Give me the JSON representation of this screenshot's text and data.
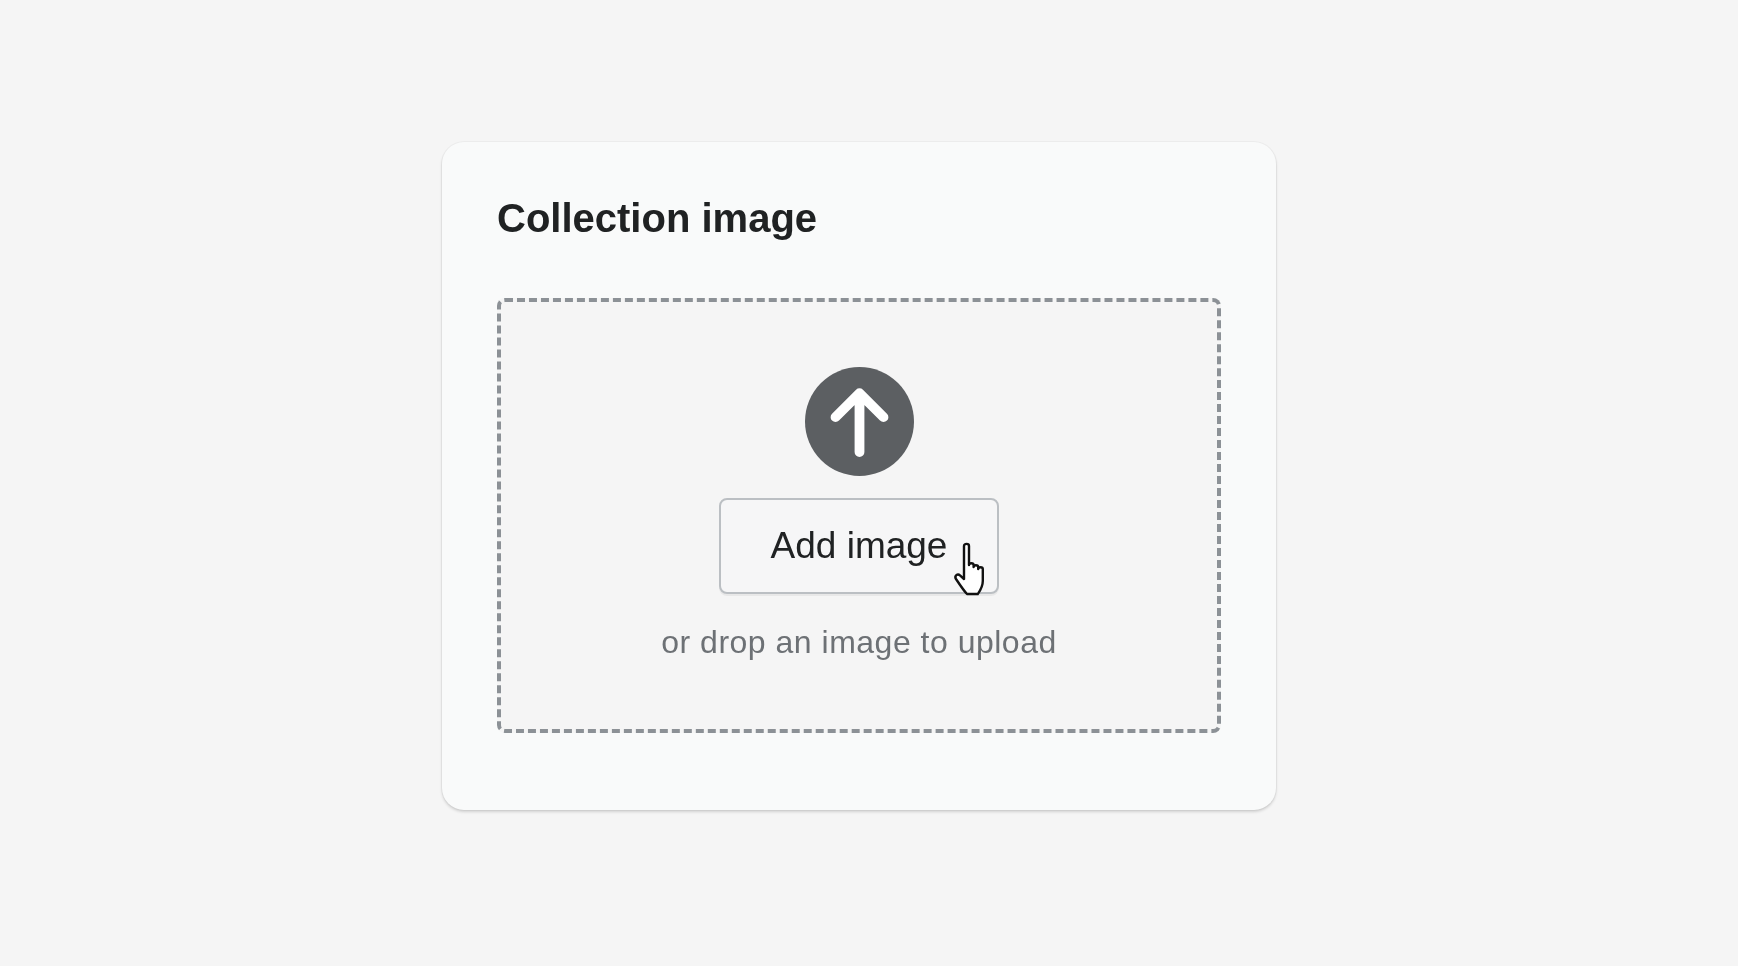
{
  "card": {
    "title": "Collection image"
  },
  "dropzone": {
    "button": "Add image",
    "hint": "or drop an image to upload"
  }
}
